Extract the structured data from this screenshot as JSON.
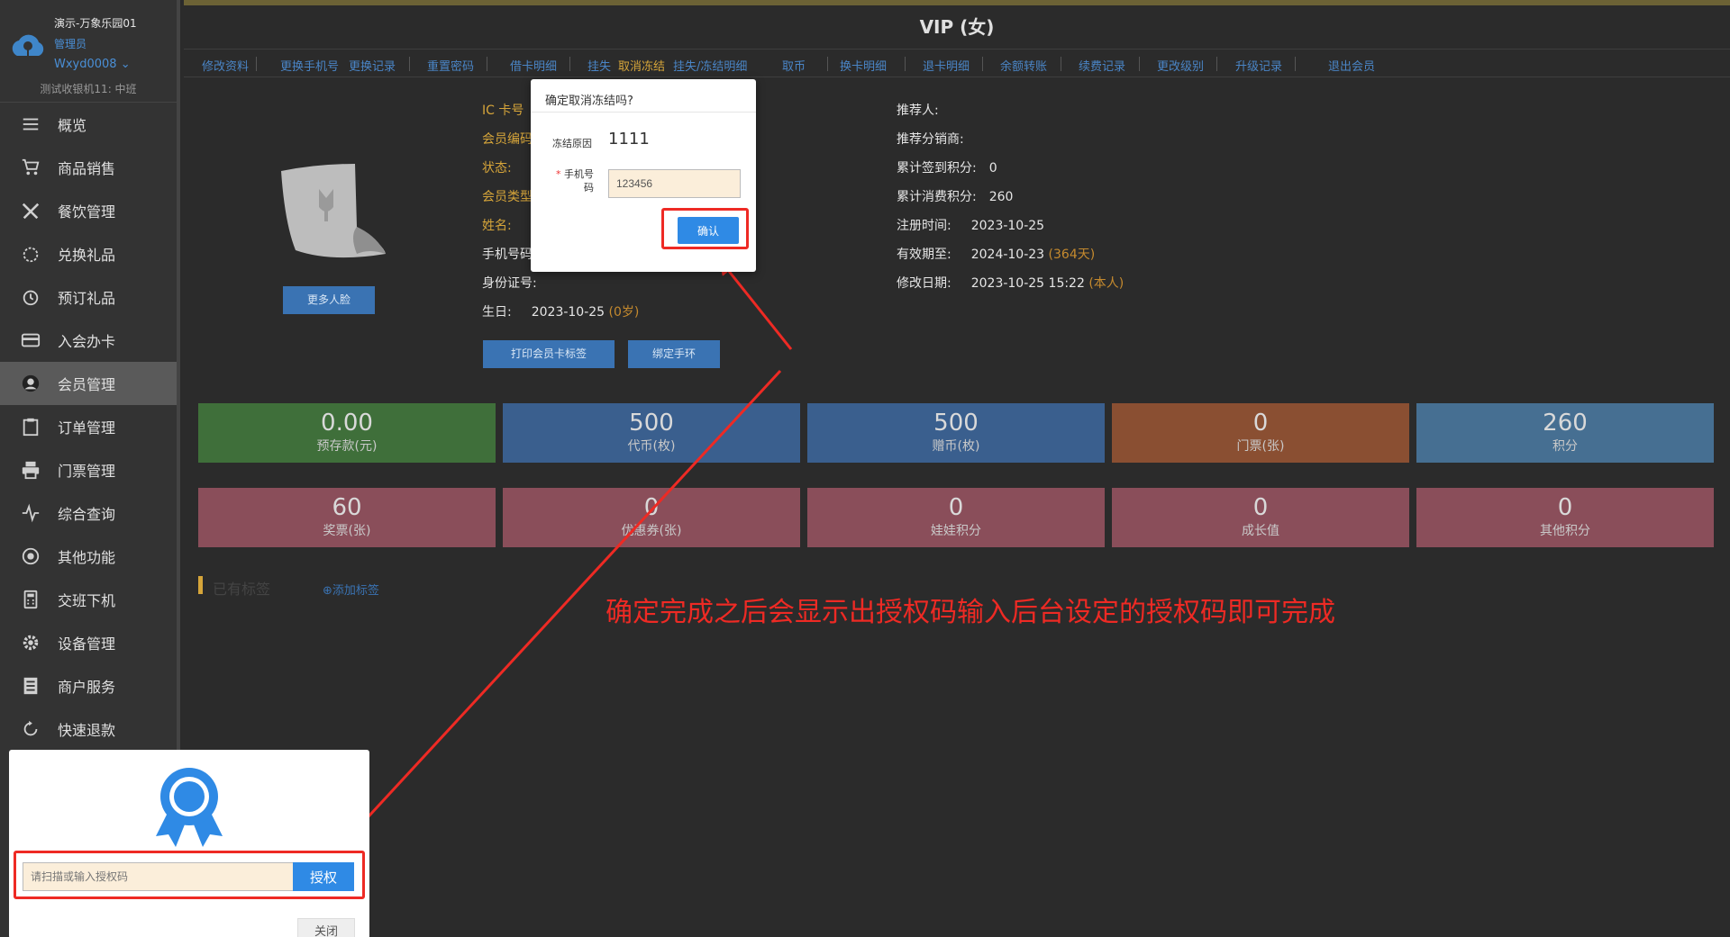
{
  "sidebar": {
    "store": "演示-万象乐园01",
    "role": "管理员",
    "user": "Wxyd0008",
    "device": "测试收银机11: 中班",
    "items": [
      {
        "label": "概览",
        "icon": "menu-icon"
      },
      {
        "label": "商品销售",
        "icon": "cart-icon"
      },
      {
        "label": "餐饮管理",
        "icon": "utensils-icon"
      },
      {
        "label": "兑换礼品",
        "icon": "gift-icon"
      },
      {
        "label": "预订礼品",
        "icon": "alarm-clock-icon"
      },
      {
        "label": "入会办卡",
        "icon": "card-icon"
      },
      {
        "label": "会员管理",
        "icon": "user-icon",
        "active": true
      },
      {
        "label": "订单管理",
        "icon": "clipboard-icon"
      },
      {
        "label": "门票管理",
        "icon": "printer-icon"
      },
      {
        "label": "综合查询",
        "icon": "pulse-icon"
      },
      {
        "label": "其他功能",
        "icon": "aperture-icon"
      },
      {
        "label": "交班下机",
        "icon": "calculator-icon"
      },
      {
        "label": "设备管理",
        "icon": "gear-icon"
      },
      {
        "label": "商户服务",
        "icon": "document-icon"
      },
      {
        "label": "快速退款",
        "icon": "refresh-icon"
      }
    ]
  },
  "header": {
    "title": "VIP (女)"
  },
  "tabs": [
    {
      "label": "修改资料"
    },
    {
      "label": "更换手机号"
    },
    {
      "label": "更换记录"
    },
    {
      "label": "重置密码"
    },
    {
      "label": "借卡明细"
    },
    {
      "label": "挂失"
    },
    {
      "label": "取消冻结",
      "highlight": true
    },
    {
      "label": "挂失/冻结明细"
    },
    {
      "label": "取币"
    },
    {
      "label": "换卡明细"
    },
    {
      "label": "退卡明细"
    },
    {
      "label": "余额转账"
    },
    {
      "label": "续费记录"
    },
    {
      "label": "更改级别"
    },
    {
      "label": "升级记录"
    },
    {
      "label": "退出会员"
    }
  ],
  "profile": {
    "more_face": "更多人脸",
    "print_label": "打印会员卡标签",
    "bind_band": "绑定手环",
    "left_fields": {
      "ic_card": "IC 卡号",
      "member_no": "会员编码",
      "status": "状态:",
      "member_type": "会员类型",
      "name": "姓名:",
      "phone": "手机号码",
      "id_no": "身份证号:",
      "birthday_label": "生日:",
      "birthday_val": "2023-10-25",
      "birthday_age": "(0岁)"
    },
    "right_fields": {
      "referrer": "推荐人:",
      "distributor": "推荐分销商:",
      "checkin_points_label": "累计签到积分:",
      "checkin_points_val": "0",
      "consume_points_label": "累计消费积分:",
      "consume_points_val": "260",
      "register_label": "注册时间:",
      "register_val": "2023-10-25",
      "valid_label": "有效期至:",
      "valid_val": "2024-10-23",
      "valid_days": "(364天)",
      "modify_label": "修改日期:",
      "modify_val": "2023-10-25 15:22",
      "modify_by": "(本人)"
    }
  },
  "stats_row1": [
    {
      "value": "0.00",
      "label": "预存款(元)",
      "color": "#3f6f3a"
    },
    {
      "value": "500",
      "label": "代币(枚)",
      "color": "#3a5f8e"
    },
    {
      "value": "500",
      "label": "赠币(枚)",
      "color": "#3a5f8e"
    },
    {
      "value": "0",
      "label": "门票(张)",
      "color": "#8a4f32"
    },
    {
      "value": "260",
      "label": "积分",
      "color": "#466f92"
    }
  ],
  "stats_row2": [
    {
      "value": "60",
      "label": "奖票(张)",
      "color": "#8a4e5a"
    },
    {
      "value": "0",
      "label": "优惠券(张)",
      "color": "#8a4e5a"
    },
    {
      "value": "0",
      "label": "娃娃积分",
      "color": "#8a4e5a"
    },
    {
      "value": "0",
      "label": "成长值",
      "color": "#8a4e5a"
    },
    {
      "value": "0",
      "label": "其他积分",
      "color": "#8a4e5a"
    }
  ],
  "tags": {
    "title": "已有标签",
    "add": "⊕添加标签"
  },
  "annotation": "确定完成之后会显示出授权码输入后台设定的授权码即可完成",
  "dialog": {
    "title": "确定取消冻结吗?",
    "reason_label": "冻结原因",
    "reason_value": "1111",
    "phone_star": "*",
    "phone_label": "手机号码",
    "phone_value": "123456",
    "confirm": "确认"
  },
  "auth": {
    "placeholder": "请扫描或输入授权码",
    "button": "授权",
    "close": "关闭"
  }
}
